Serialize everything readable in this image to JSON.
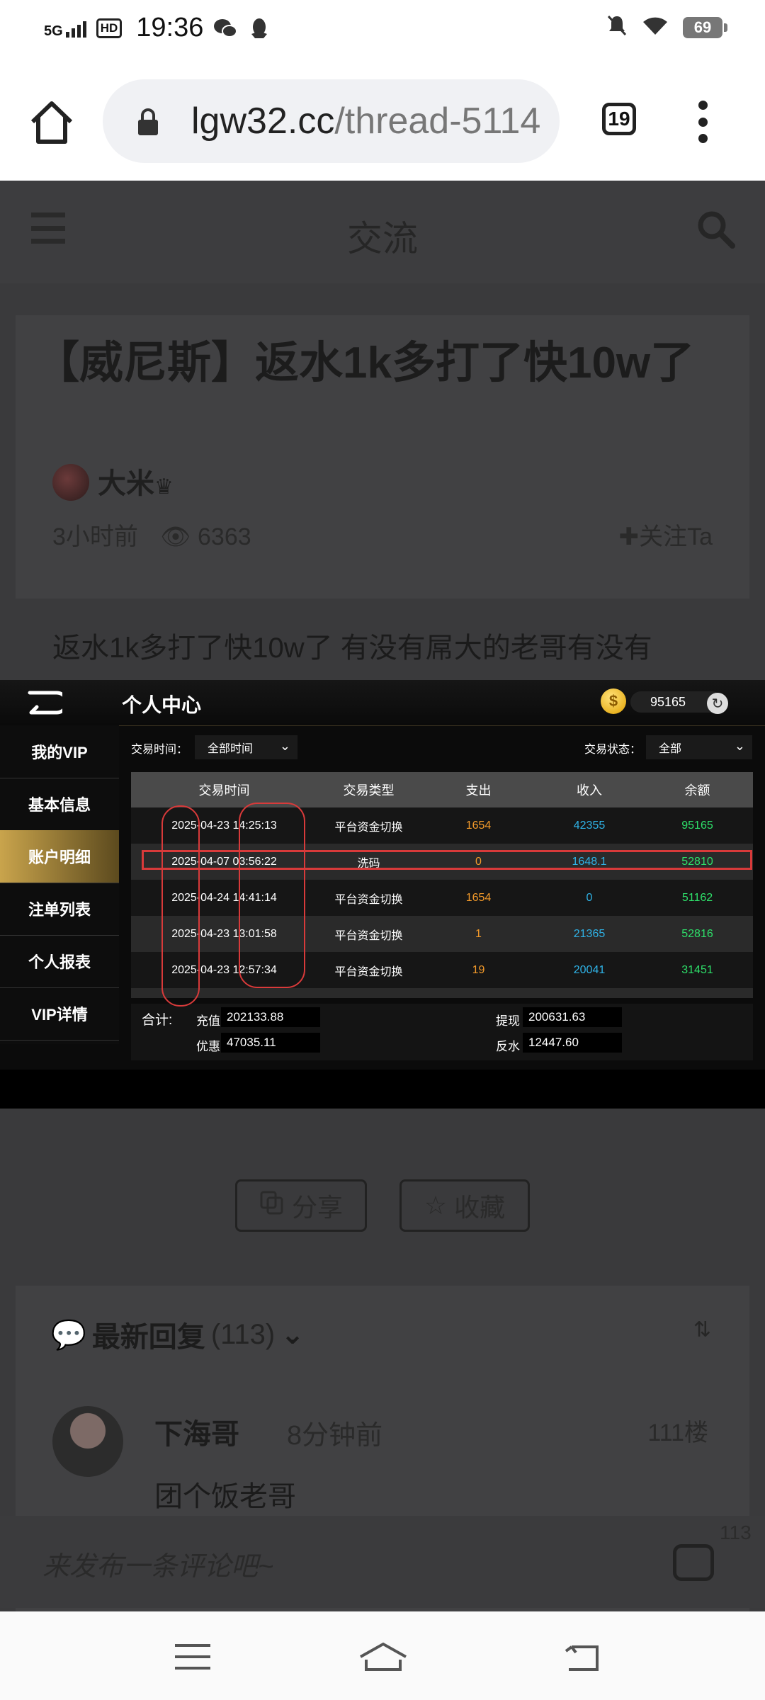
{
  "status_bar": {
    "network": "5G",
    "hd": "HD",
    "time": "19:36",
    "battery": "69"
  },
  "browser": {
    "url_host": "lgw32.cc",
    "url_path": "/thread-5114",
    "tab_count": "19"
  },
  "page": {
    "header_title": "交流",
    "post_title": "【威尼斯】返水1k多打了快10w了",
    "author": "大米",
    "time_ago": "3小时前",
    "views": "6363",
    "follow_label": "关注Ta",
    "body_text": "返水1k多打了快10w了 有没有屌大的老哥有没有"
  },
  "screenshot": {
    "title": "个人中心",
    "balance": "95165",
    "coin_glyph": "$",
    "sidebar": [
      "我的VIP",
      "基本信息",
      "账户明细",
      "注单列表",
      "个人报表",
      "VIP详情"
    ],
    "filter_time_label": "交易时间：",
    "filter_time_value": "全部时间",
    "filter_status_label": "交易状态：",
    "filter_status_value": "全部",
    "columns": [
      "交易时间",
      "交易类型",
      "支出",
      "收入",
      "余额"
    ],
    "rows": [
      {
        "time": "2025-04-23 14:25:13",
        "type": "平台资金切换",
        "out": "1654",
        "in": "42355",
        "balance": "95165"
      },
      {
        "time": "2025-04-07 03:56:22",
        "type": "洗码",
        "out": "0",
        "in": "1648.1",
        "balance": "52810"
      },
      {
        "time": "2025-04-24 14:41:14",
        "type": "平台资金切换",
        "out": "1654",
        "in": "0",
        "balance": "51162"
      },
      {
        "time": "2025-04-23 13:01:58",
        "type": "平台资金切换",
        "out": "1",
        "in": "21365",
        "balance": "52816"
      },
      {
        "time": "2025-04-23 12:57:34",
        "type": "平台资金切换",
        "out": "19",
        "in": "20041",
        "balance": "31451"
      }
    ],
    "totals_label": "合计:",
    "totals": {
      "recharge_label": "充值",
      "recharge": "202133.88",
      "withdraw_label": "提现",
      "withdraw": "200631.63",
      "bonus_label": "优惠",
      "bonus": "47035.11",
      "rebate_label": "反水",
      "rebate": "12447.60"
    }
  },
  "actions": {
    "share": "分享",
    "favorite": "收藏"
  },
  "replies": {
    "heading": "最新回复",
    "count": "(113)",
    "first": {
      "name": "下海哥",
      "time": "8分钟前",
      "floor": "111楼",
      "text": "团个饭老哥"
    }
  },
  "comment": {
    "placeholder": "来发布一条评论吧~",
    "count": "113"
  },
  "colors": {
    "expense": "#f39a2a",
    "income": "#2fb3e7",
    "balance": "#2ee06a",
    "highlight": "#d83a3a",
    "active_tab": "#c9a44c"
  }
}
